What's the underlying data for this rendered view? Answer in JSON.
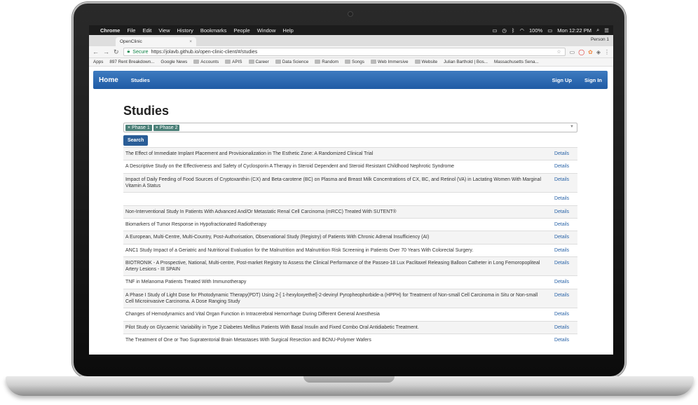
{
  "menubar": {
    "apple": "",
    "app": "Chrome",
    "menus": [
      "File",
      "Edit",
      "View",
      "History",
      "Bookmarks",
      "People",
      "Window",
      "Help"
    ],
    "battery": "100%",
    "clock": "Mon 12:22 PM"
  },
  "browser": {
    "tab_title": "OpenClinic",
    "person": "Person 1",
    "secure_label": "Secure",
    "url": "https://jolavb.github.io/open-clinic-client/#/studies",
    "bookmarks": [
      "Apps",
      "897 Rent Breakdown...",
      "Google News",
      "Accounts",
      "APIS",
      "Career",
      "Data Science",
      "Random",
      "Songs",
      "Web Immersive",
      "Website",
      "Julian Barthold | Bos...",
      "Massachusetts Sena..."
    ]
  },
  "navbar": {
    "brand": "Home",
    "link": "Studies",
    "signup": "Sign Up",
    "signin": "Sign In"
  },
  "page": {
    "title": "Studies",
    "filters": [
      "Phase 1",
      "Phase 2"
    ],
    "search_button": "Search",
    "details_label": "Details",
    "studies": [
      "The Effect of Immediate Implant Placement and Provisionalization in The Esthetic Zone: A Randomized Clinical Trial",
      "A Descriptive Study on the Effectiveness and Safety of Cyclosporin A Therapy in Steroid Dependent and Steroid Resistant Childhood Nephrotic Syndrome",
      "Impact of Daily Feeding of Food Sources of Cryptoxanthin (CX) and Beta-carotene (BC) on Plasma and Breast Milk Concentrations of CX, BC, and Retinol (VA) in Lactating Women With Marginal Vitamin A Status",
      "",
      "Non-Interventional Study In Patients With Advanced And/Or Metastatic Renal Cell Carcinoma (mRCC) Treated With SUTENT®",
      "Biomarkers of Tumor Response in Hypofractionated Radiotherapy",
      "A European, Multi-Centre, Multi-Country, Post-Authorisation, Observational Study (Registry) of Patients With Chronic Adrenal Insufficiency (AI)",
      "ANC1 Study Impact of a Geriatric and Nutritional Evaluation for the Malnutrition and Malnutrition Risk Screening in Patients Over 70 Years With Colorectal Surgery.",
      "BIOTRONIK - A Prospective, National, Multi-centre, Post-market Registry to Assess the Clinical Performance of the Passeo-18 Lux Paclitaxel Releasing Balloon Catheter in Long Femoropopliteal Artery Lesions - III SPAIN",
      "TNF in Melanoma Patients Treated With Immunotherapy",
      "A Phase I Study of Light Dose for Photodynamic Therapy(PDT) Using 2-[ 1-hexyloxyethel]-2-devinyl Pyropheophorbide-a (HPPH) for Treatment of Non-small Cell Carcinoma in Situ or Non-small Cell Microinvasive Carcinoma. A Dose Ranging Study",
      "Changes of Hemodynamics and Vital Organ Function in Intracerebral Hemorrhage During Different General Anesthesia",
      "Pilot Study on Glycaemic Variability in Type 2 Diabetes Mellitus Patients With Basal Insulin and Fixed Combo Oral Antidiabetic Treatment.",
      "The Treatment of One or Two Supratentorial Brain Metastases With Surgical Resection and BCNU-Polymer Wafers"
    ]
  }
}
